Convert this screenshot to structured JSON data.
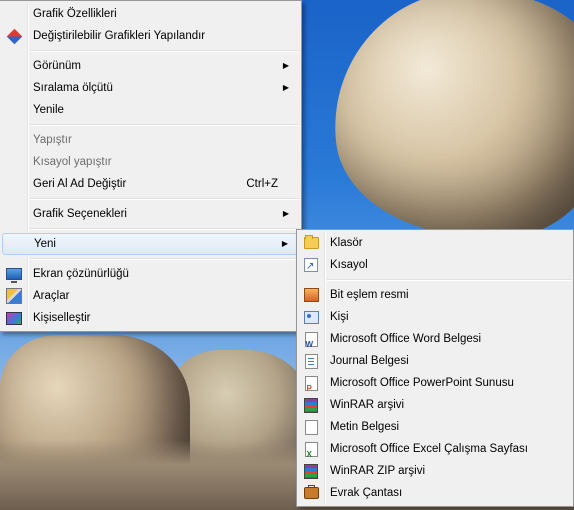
{
  "main_menu": {
    "items": [
      {
        "label": "Grafik Özellikleri",
        "icon": null,
        "disabled": false
      },
      {
        "label": "Değiştirilebilir Grafikleri Yapılandır",
        "icon": "graphics-diamond-icon",
        "disabled": false
      },
      {
        "label": "Görünüm",
        "submenu": true
      },
      {
        "label": "Sıralama ölçütü",
        "submenu": true
      },
      {
        "label": "Yenile"
      },
      {
        "label": "Yapıştır",
        "disabled": true
      },
      {
        "label": "Kısayol yapıştır",
        "disabled": true
      },
      {
        "label": "Geri Al Ad Değiştir",
        "shortcut": "Ctrl+Z"
      },
      {
        "label": "Grafik Seçenekleri",
        "submenu": true
      },
      {
        "label": "Yeni",
        "submenu": true,
        "highlighted": true
      },
      {
        "label": "Ekran çözünürlüğü",
        "icon": "monitor-icon"
      },
      {
        "label": "Araçlar",
        "icon": "tools-icon"
      },
      {
        "label": "Kişiselleştir",
        "icon": "personalize-icon"
      }
    ]
  },
  "sub_menu": {
    "items": [
      {
        "label": "Klasör",
        "icon": "folder-icon"
      },
      {
        "label": "Kısayol",
        "icon": "shortcut-icon"
      },
      {
        "label": "Bit eşlem resmi",
        "icon": "bitmap-icon"
      },
      {
        "label": "Kişi",
        "icon": "contact-icon"
      },
      {
        "label": "Microsoft Office Word Belgesi",
        "icon": "word-document-icon"
      },
      {
        "label": "Journal Belgesi",
        "icon": "journal-document-icon"
      },
      {
        "label": "Microsoft Office PowerPoint Sunusu",
        "icon": "powerpoint-icon"
      },
      {
        "label": "WinRAR arşivi",
        "icon": "winrar-icon"
      },
      {
        "label": "Metin Belgesi",
        "icon": "text-document-icon"
      },
      {
        "label": "Microsoft Office Excel Çalışma Sayfası",
        "icon": "excel-icon"
      },
      {
        "label": "WinRAR ZIP arşivi",
        "icon": "winrar-zip-icon"
      },
      {
        "label": "Evrak Çantası",
        "icon": "briefcase-icon"
      }
    ]
  },
  "colors": {
    "menu_bg": "#f0f0f0",
    "highlight_border": "#aecff7",
    "disabled_text": "#6d6d6d"
  }
}
